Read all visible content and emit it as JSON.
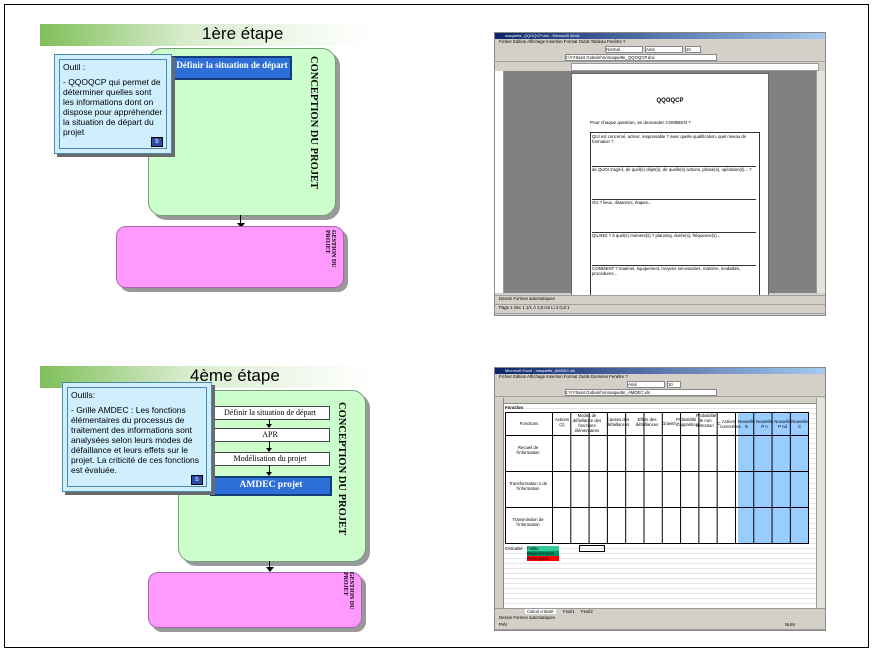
{
  "slide1": {
    "title": "1ère étape",
    "box_label": "Définir la situation de départ",
    "vertical_title": "CONCEPTION DU PROJET",
    "pink_title": "GESTION DU PROJET",
    "callout_title": "Outil :",
    "callout_body": "- QQOQCP qui permet de déterminer quelles sont les informations dont on dispose pour appréhender la situation de départ du projet",
    "callout_button": "b"
  },
  "word": {
    "window_title": "maquette_QQOQCP.doc - Microsoft Word",
    "menu": "Fichier  Edition  Affichage  Insertion  Format  Outils  Tableau  Fenêtre  ?",
    "font_style": "Normal",
    "font_name": "Arial",
    "font_size": "10",
    "address": "I:\\YYSaint Gobain\\Vu\\maquette_QQOQCP.doc",
    "doc_title": "QQOQCP",
    "intro": "Pour chaque question, se demander COMBIEN ?",
    "rows": [
      "QUI est concerné, acteur, responsable ? avec quelle qualification, quel niveau de formation ?",
      "de QUOI s'agit-il, de quel(s) objet(s), de quelle(s) actions, phase(s), opération(s)... ?",
      "OU ? lieux, distances, étapes...",
      "QUAND ? à quel(s) moment(s) ? planning, durée(s), fréquence(s)...",
      "COMMENT ? matériel, équipement, moyens nécessaires, manière, modalités, procédures..."
    ],
    "status": "Page 1    Sec 1    1/1    À 2,5 cm    Li 1    Col 1",
    "drawing": "Dessin  Formes automatiques"
  },
  "slide2": {
    "title": "4ème étape",
    "steps": [
      "Définir la situation de départ",
      "APR",
      "Modélisation du projet",
      "AMDEC projet"
    ],
    "vertical_title": "CONCEPTION DU PROJET",
    "pink_title": "GESTION DU PROJET",
    "callout_title": "Outils:",
    "callout_body": "- Grille AMDEC : Les fonctions élémentaires du processus de traitement des informations sont analysées selon leurs modes de défaillance et leurs effets sur le projet. La criticité de ces fonctions est évaluée.",
    "callout_button": "b"
  },
  "excel": {
    "window_title": "Microsoft Excel - maquette_AMDEC.xls",
    "menu": "Fichier  Edition  Affichage  Insertion  Format  Outils  Données  Fenêtre  ?",
    "font_name": "Arial",
    "font_size": "10",
    "address": "I:\\YYSaint Gobain\\Vu\\maquette_AMDEC.xls",
    "section": "Fonction",
    "headers": [
      "Fonctions",
      "Actions (1)",
      "Modes de défaillance des fonctions élémentaires",
      "Causes des défaillances",
      "Effets des défaillances",
      "Gravité",
      "Probabilité d'apparition",
      "Probabilité de non détection",
      "C",
      "Actions correctives",
      "Nouvelle G",
      "Nouvelle P n",
      "Nouvelle P nd",
      "Nouvelle C"
    ],
    "row_labels": [
      "Recueil de l'information",
      "Transformation n de l'information",
      "Transmission de l'information"
    ],
    "legend_label": "Criticalité",
    "legend_items": [
      "Faible",
      "Moyennement",
      "Forte grave"
    ],
    "sheet_tabs": [
      "Calcul criticité",
      "Feuil1",
      "Feuil2"
    ],
    "status_left": "Prêt",
    "status_right": "NUM",
    "colors": {
      "blue_cols": "#99ccff",
      "legend_green": "#33cc99",
      "legend_teal": "#009966",
      "legend_red": "#ff0000"
    }
  }
}
